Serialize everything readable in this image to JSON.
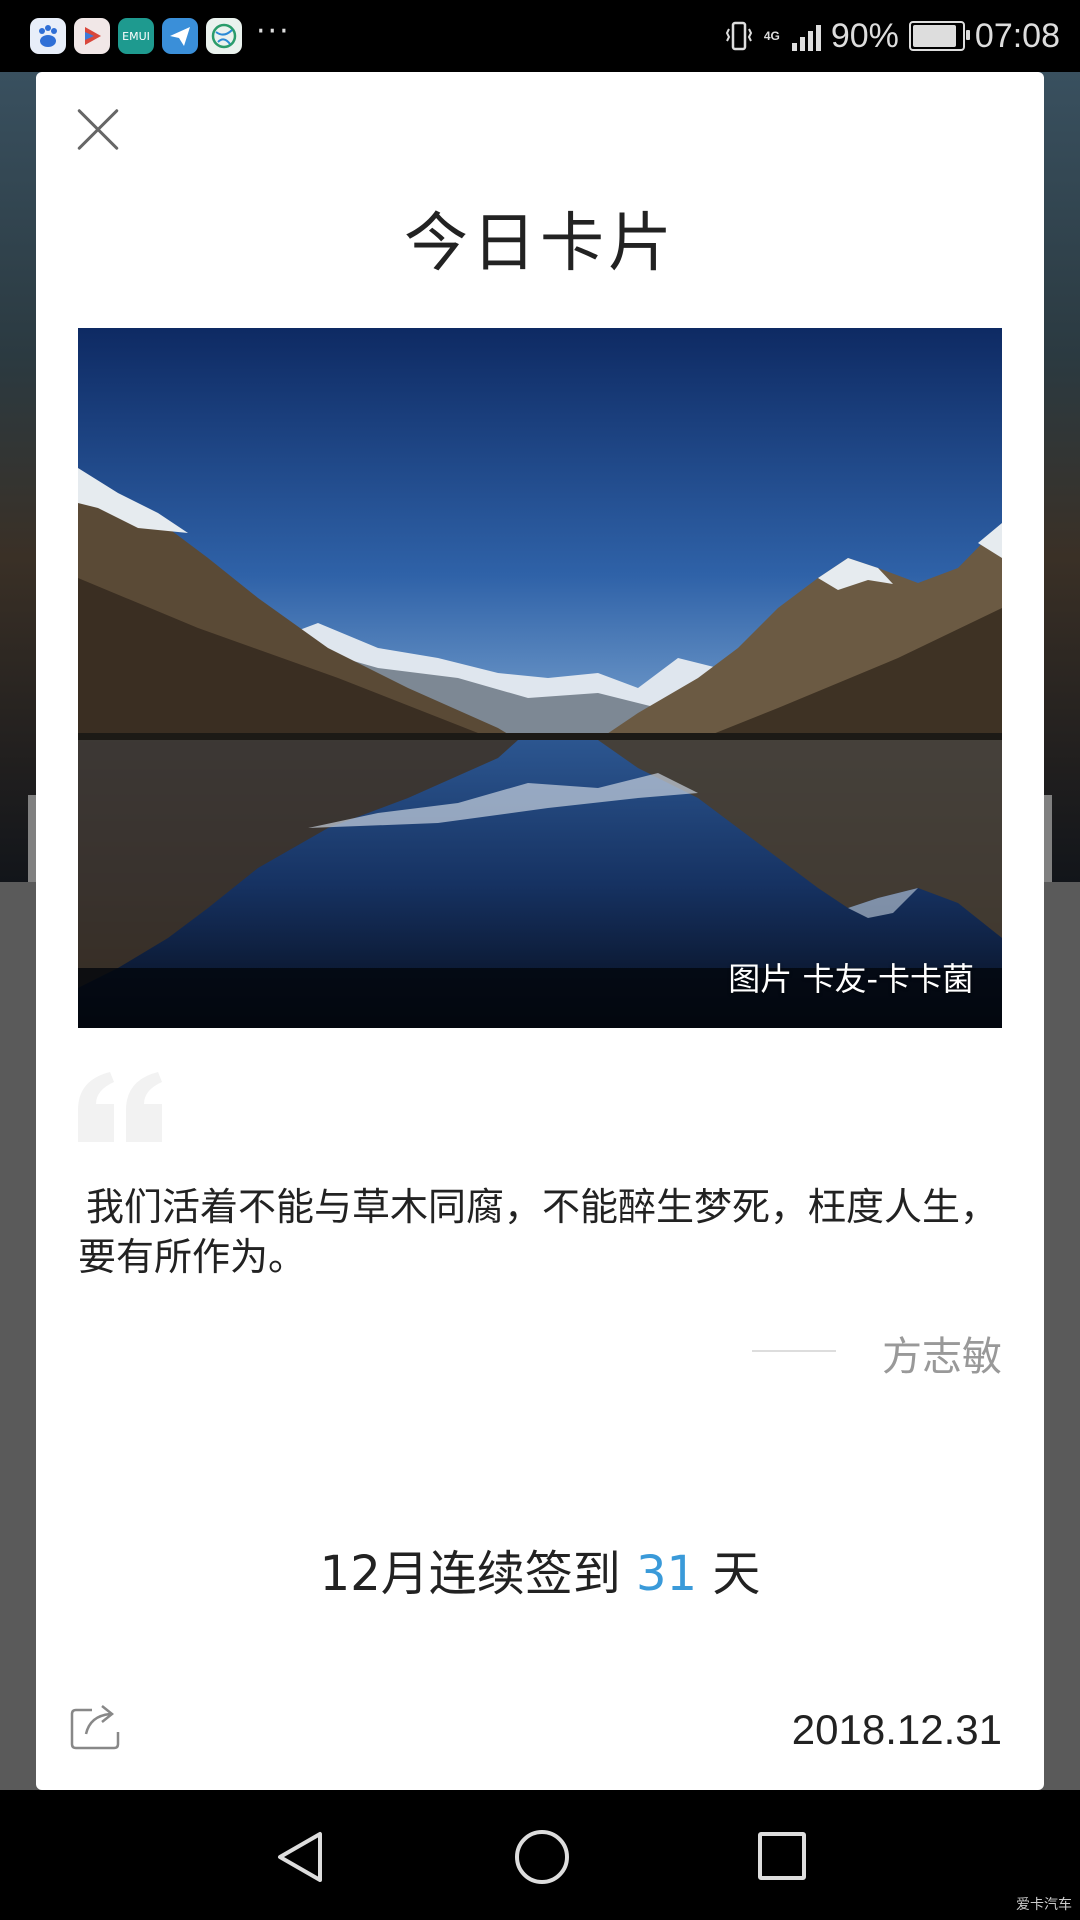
{
  "status_bar": {
    "app_icons": [
      "baidu-icon",
      "video-player-icon",
      "emui-icon",
      "paper-plane-icon",
      "browser-globe-icon"
    ],
    "emui_label": "EMUI",
    "more": "···",
    "network": "4G",
    "battery_percent": "90%",
    "battery_level": 0.9,
    "time": "07:08"
  },
  "card": {
    "title": "今日卡片",
    "photo_credit": "图片 卡友-卡卡菌",
    "quote": "我们活着不能与草木同腐，不能醉生梦死，枉度人生，要有所作为。",
    "author": "方志敏",
    "checkin": {
      "prefix": "12月连续签到 ",
      "days": "31",
      "suffix": " 天"
    },
    "date": "2018.12.31"
  },
  "watermark": "爱卡汽车",
  "colors": {
    "accent": "#3a9ad9",
    "card_bg": "#ffffff",
    "author_gray": "#999999"
  }
}
